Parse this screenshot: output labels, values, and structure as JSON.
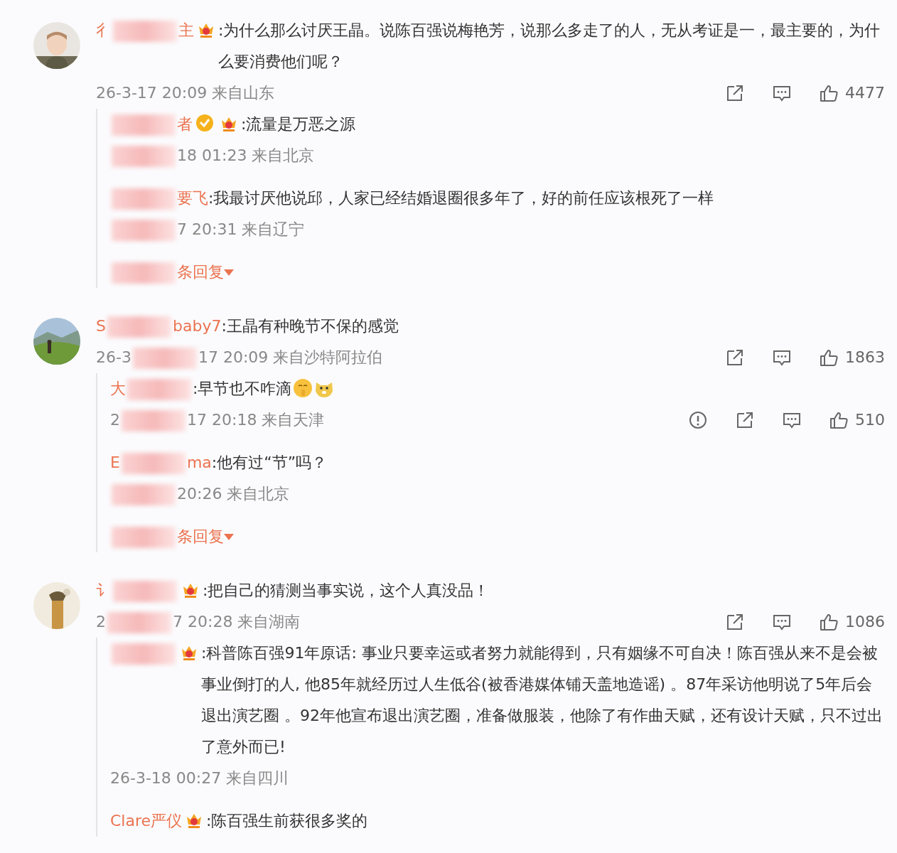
{
  "comments": [
    {
      "avatar": {
        "kind": "picture"
      },
      "name": [
        {
          "kind": "text",
          "text": "彳"
        },
        {
          "kind": "blur"
        },
        {
          "kind": "text",
          "text": "主"
        }
      ],
      "badges": [
        {
          "kind": "vip"
        }
      ],
      "text": ":为什么那么讨厌王晶。说陈百强说梅艳芳，说那么多走了的人，无从考证是一，最主要的，为什么要消费他们呢？",
      "time": [
        {
          "kind": "text",
          "text": "26-3-17 20:09 来自山东"
        }
      ],
      "likes": "4477",
      "replies": [
        {
          "name": [
            {
              "kind": "blur"
            },
            {
              "kind": "text",
              "text": "者"
            }
          ],
          "badges": [
            {
              "kind": "verified"
            },
            {
              "kind": "vip"
            }
          ],
          "text": ":流量是万恶之源",
          "time": [
            {
              "kind": "blur"
            },
            {
              "kind": "text",
              "text": "18 01:23 来自北京"
            }
          ]
        },
        {
          "name": [
            {
              "kind": "blur"
            },
            {
              "kind": "text",
              "text": "要飞"
            }
          ],
          "text": ":我最讨厌他说邱，人家已经结婚退圈很多年了，好的前任应该根死了一样",
          "time": [
            {
              "kind": "blur"
            },
            {
              "kind": "text",
              "text": "7 20:31 来自辽宁"
            }
          ]
        }
      ],
      "more_replies": [
        {
          "kind": "blur"
        },
        {
          "kind": "text",
          "text": "条回复"
        }
      ]
    },
    {
      "avatar": {
        "kind": "picture"
      },
      "name": [
        {
          "kind": "text",
          "text": "S"
        },
        {
          "kind": "blur"
        },
        {
          "kind": "text",
          "text": "baby7"
        }
      ],
      "text": ":王晶有种晚节不保的感觉",
      "time": [
        {
          "kind": "text",
          "text": "26-3"
        },
        {
          "kind": "blur"
        },
        {
          "kind": "text",
          "text": "17 20:09 来自沙特阿拉伯"
        }
      ],
      "likes": "1863",
      "replies": [
        {
          "name": [
            {
              "kind": "text",
              "text": "大"
            },
            {
              "kind": "blur"
            }
          ],
          "text": ":早节也不咋滴",
          "emojis": [
            {
              "kind": "shush"
            },
            {
              "kind": "doge"
            }
          ],
          "time": [
            {
              "kind": "text",
              "text": "2"
            },
            {
              "kind": "blur"
            },
            {
              "kind": "text",
              "text": "17 20:18 来自天津"
            }
          ],
          "report": true,
          "likes": "510"
        },
        {
          "name": [
            {
              "kind": "text",
              "text": "E"
            },
            {
              "kind": "blur"
            },
            {
              "kind": "text",
              "text": "ma"
            }
          ],
          "text": ":他有过“节”吗？",
          "time": [
            {
              "kind": "blur"
            },
            {
              "kind": "text",
              "text": "20:26 来自北京"
            }
          ]
        }
      ],
      "more_replies": [
        {
          "kind": "blur"
        },
        {
          "kind": "text",
          "text": "条回复"
        }
      ]
    },
    {
      "avatar": {
        "kind": "picture"
      },
      "name": [
        {
          "kind": "text",
          "text": "讠"
        },
        {
          "kind": "blur"
        }
      ],
      "badges": [
        {
          "kind": "vip"
        }
      ],
      "text": ":把自己的猜测当事实说，这个人真没品！",
      "time": [
        {
          "kind": "text",
          "text": "2"
        },
        {
          "kind": "blur"
        },
        {
          "kind": "text",
          "text": "7 20:28 来自湖南"
        }
      ],
      "likes": "1086",
      "replies": [
        {
          "name": [
            {
              "kind": "blur"
            }
          ],
          "badges": [
            {
              "kind": "vip"
            }
          ],
          "text": ":科普陈百强91年原话: 事业只要幸运或者努力就能得到，只有姻缘不可自决！陈百强从来不是会被事业倒打的人, 他85年就经历过人生低谷(被香港媒体铺天盖地造谣) 。87年采访他明说了5年后会退出演艺圈 。92年他宣布退出演艺圈，准备做服装，他除了有作曲天赋，还有设计天赋，只不过出了意外而已!",
          "time": [
            {
              "kind": "text",
              "text": "26-3-18 00:27 来自四川"
            }
          ]
        },
        {
          "name": [
            {
              "kind": "text",
              "text": "Clare严仪"
            }
          ],
          "badges": [
            {
              "kind": "vip"
            }
          ],
          "text": ":陈百强生前获很多奖的"
        }
      ]
    }
  ]
}
